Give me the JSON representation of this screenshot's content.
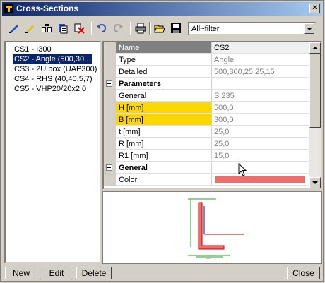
{
  "window": {
    "title": "Cross-Sections",
    "close_glyph": "×"
  },
  "toolbar": {
    "icons": [
      "new-icon",
      "edit-icon",
      "copy-icon",
      "paste-icon",
      "delete-icon",
      "undo-icon",
      "redo-icon",
      "print-icon",
      "open-icon",
      "save-icon"
    ],
    "filter": {
      "value": "All~filter"
    }
  },
  "sections": [
    {
      "label": "CS1 - I300"
    },
    {
      "label": "CS2 - Angle (500,30..."
    },
    {
      "label": "CS3 - 2U box (UAP300)"
    },
    {
      "label": "CS4 - RHS (40,40,5,7)"
    },
    {
      "label": "CS5 - VHP20/20x2.0"
    }
  ],
  "selected_index": 1,
  "properties": {
    "rows": [
      {
        "name": "Name",
        "value": "CS2"
      },
      {
        "name": "Type",
        "value": "Angle"
      },
      {
        "name": "Detailed",
        "value": "500,300,25,25,15"
      },
      {
        "name": "Parameters",
        "value": ""
      },
      {
        "name": "General",
        "value": "S 235"
      },
      {
        "name": "H [mm]",
        "value": "500,0"
      },
      {
        "name": "B [mm]",
        "value": "300,0"
      },
      {
        "name": "t [mm]",
        "value": "25,0"
      },
      {
        "name": "R [mm]",
        "value": "25,0"
      },
      {
        "name": "R1 [mm]",
        "value": "15,0"
      },
      {
        "name": "General",
        "value": ""
      },
      {
        "name": "Color",
        "value": ""
      }
    ],
    "color_swatch": "#f26b6b",
    "highlight": "#ffd700"
  },
  "buttons": {
    "new": "New",
    "edit": "Edit",
    "delete": "Delete",
    "close": "Close"
  }
}
